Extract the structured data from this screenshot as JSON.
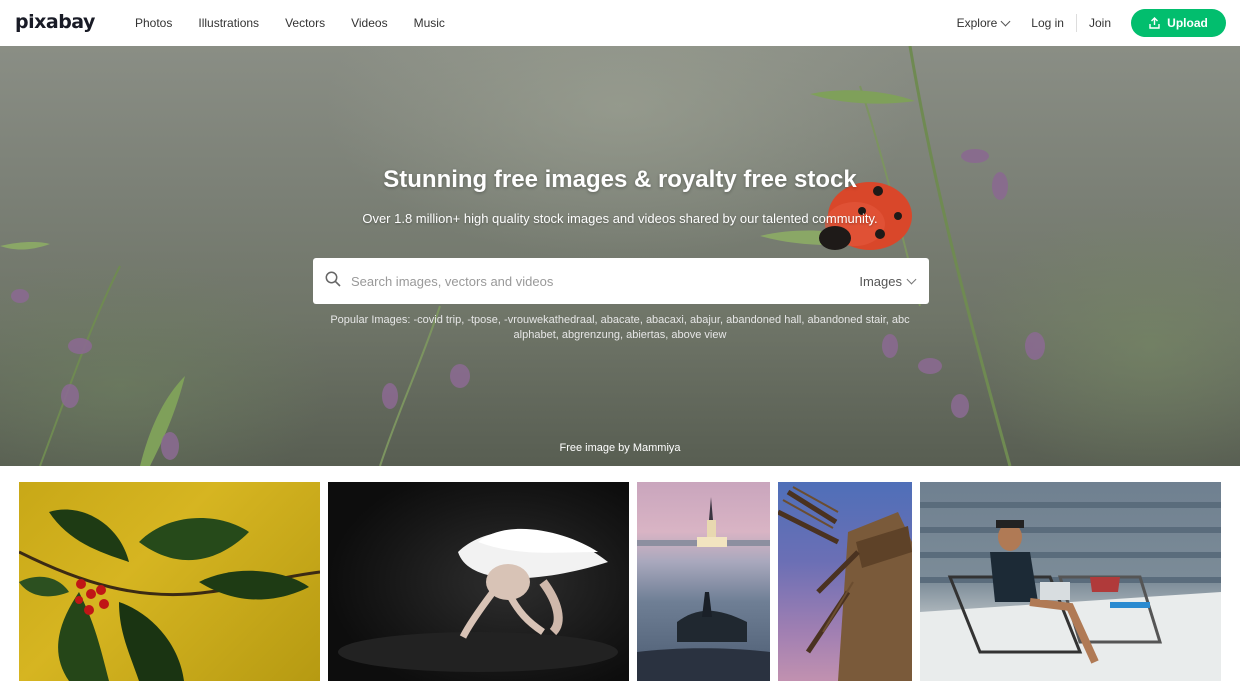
{
  "header": {
    "logo": "pixabay",
    "nav": [
      "Photos",
      "Illustrations",
      "Vectors",
      "Videos",
      "Music"
    ],
    "explore": "Explore",
    "login": "Log in",
    "join": "Join",
    "upload": "Upload",
    "accent_color": "#02be6e"
  },
  "hero": {
    "title": "Stunning free images & royalty free stock",
    "subtitle": "Over 1.8 million+ high quality stock images and videos shared by our talented community.",
    "search_placeholder": "Search images, vectors and videos",
    "search_type": "Images",
    "popular_label": "Popular Images:",
    "popular_terms": [
      "-covid trip",
      "-tpose",
      "-vrouwekathedraal",
      "abacate",
      "abacaxi",
      "abajur",
      "abandoned hall",
      "abandoned stair",
      "abc",
      "alphabet",
      "abgrenzung",
      "abiertas",
      "above view"
    ],
    "credit_prefix": "Free image by",
    "credit_author": "Mammiya"
  },
  "gallery": {
    "tiles": [
      "holly-branch",
      "ballerina",
      "maiden-tower",
      "windmill",
      "man-on-lounger"
    ]
  }
}
